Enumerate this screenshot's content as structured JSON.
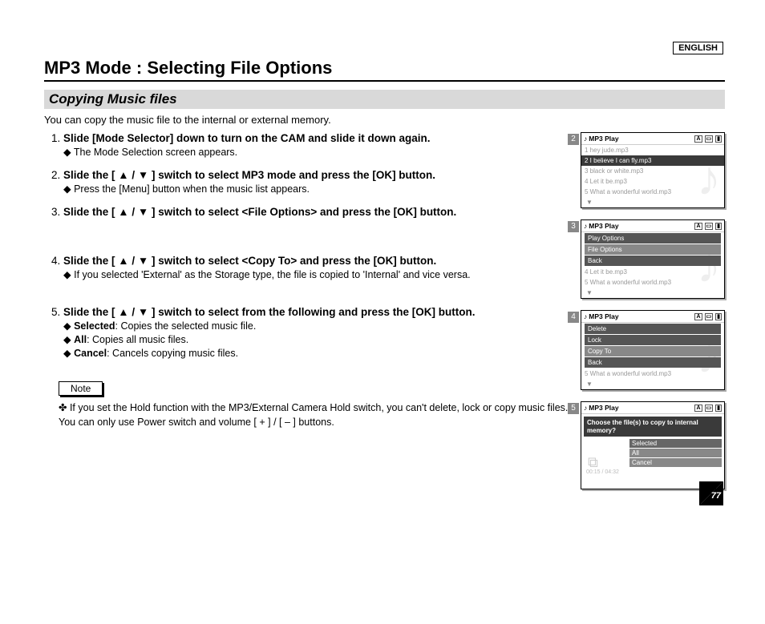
{
  "language": "ENGLISH",
  "title": "MP3 Mode : Selecting File Options",
  "section": "Copying Music files",
  "intro": "You can copy the music file to the internal or external memory.",
  "steps": {
    "s1": {
      "title": "Slide [Mode Selector] down to turn on the CAM and slide it down again.",
      "sub1": "The Mode Selection screen appears."
    },
    "s2": {
      "title_a": "Slide the [ ",
      "title_b": " ] switch to select MP3 mode and press the [OK] button.",
      "sub1": "Press the [Menu] button when the music list appears."
    },
    "s3": {
      "title_a": "Slide the [ ",
      "title_b": " ] switch to select <File Options> and press the [OK] button."
    },
    "s4": {
      "title_a": "Slide the [ ",
      "title_b": " ] switch to select <Copy To> and press the [OK] button.",
      "sub1": "If you selected 'External' as the Storage type, the file is copied to 'Internal' and vice versa."
    },
    "s5": {
      "title_a": "Slide the [ ",
      "title_b": " ] switch to select from the following and press the [OK] button.",
      "opt1_label": "Selected",
      "opt1_desc": ": Copies the selected music file.",
      "opt2_label": "All",
      "opt2_desc": ": Copies all music files.",
      "opt3_label": "Cancel",
      "opt3_desc": ": Cancels copying music files."
    }
  },
  "note_label": "Note",
  "note_text": "If you set the Hold function with the MP3/External Camera Hold switch, you can't delete, lock or copy music files. You can only use Power switch and volume [ + ] / [ – ] buttons.",
  "arrows": "▲ / ▼",
  "page_number": "77",
  "mockups": {
    "header": "MP3 Play",
    "list": {
      "r1": "1  hey jude.mp3",
      "r2": "2  I believe I can fly.mp3",
      "r3": "3  black or white.mp3",
      "r4": "4  Let it be.mp3",
      "r5": "5  What a wonderful world.mp3"
    },
    "menu3": {
      "a": "Play Options",
      "b": "File Options",
      "c": "Back"
    },
    "menu4": {
      "a": "Delete",
      "b": "Lock",
      "c": "Copy To",
      "d": "Back"
    },
    "panel5": {
      "caption": "Choose the file(s) to copy to internal memory?",
      "o1": "Selected",
      "o2": "All",
      "o3": "Cancel",
      "time": "00:15 / 04:32"
    },
    "step2": "2",
    "step3": "3",
    "step4": "4",
    "step5": "5",
    "arrow_down": "▼"
  }
}
